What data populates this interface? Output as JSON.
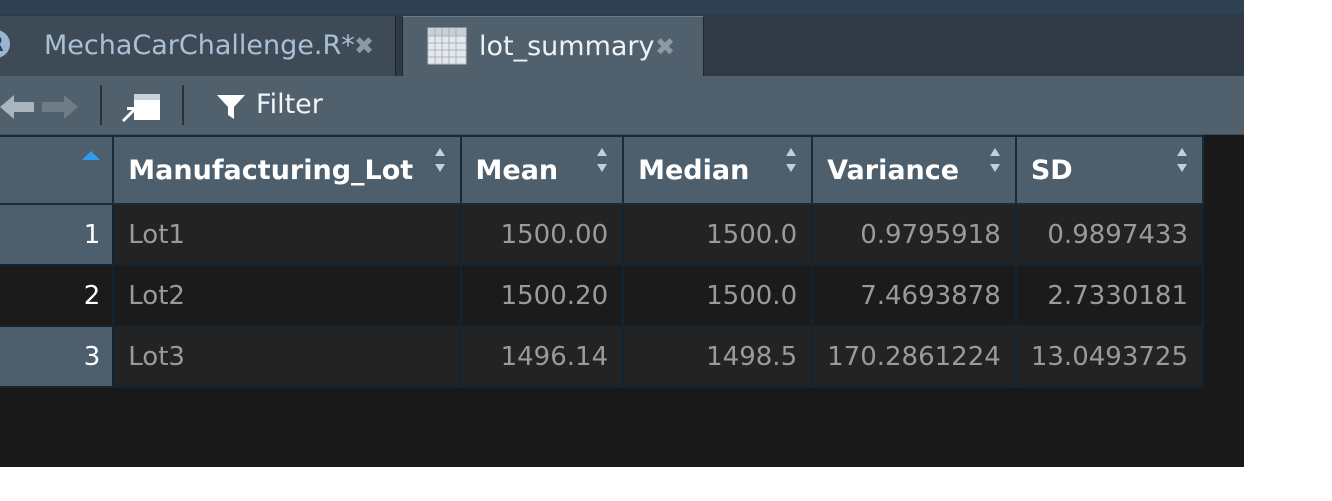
{
  "tabs": [
    {
      "label": "MechaCarChallenge.R*",
      "icon": "r-file-icon",
      "active": false
    },
    {
      "label": "lot_summary",
      "icon": "grid-icon",
      "active": true
    }
  ],
  "toolbar": {
    "filter_label": "Filter"
  },
  "table": {
    "columns": [
      "Manufacturing_Lot",
      "Mean",
      "Median",
      "Variance",
      "SD"
    ],
    "rows": [
      {
        "index": "1",
        "cells": [
          "Lot1",
          "1500.00",
          "1500.0",
          "0.9795918",
          "0.9897433"
        ]
      },
      {
        "index": "2",
        "cells": [
          "Lot2",
          "1500.20",
          "1500.0",
          "7.4693878",
          "2.7330181"
        ]
      },
      {
        "index": "3",
        "cells": [
          "Lot3",
          "1496.14",
          "1498.5",
          "170.2861224",
          "13.0493725"
        ]
      }
    ]
  },
  "colors": {
    "accent": "#2f9cf0",
    "header_bg": "#4d5e6d",
    "panel_bg": "#191919"
  }
}
